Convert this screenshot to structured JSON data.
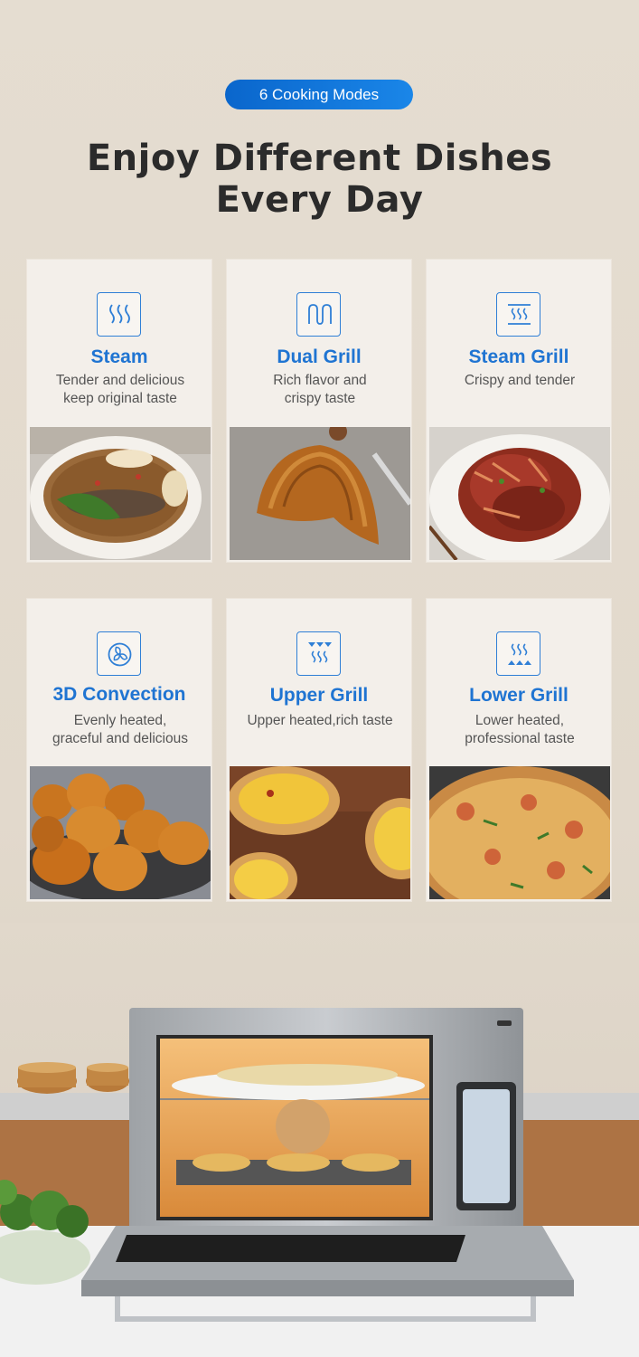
{
  "badge": {
    "label": "6 Cooking Modes"
  },
  "headline": {
    "line1": "Enjoy Different Dishes",
    "line2": "Every Day"
  },
  "colors": {
    "accent": "#1f74d2",
    "badge_start": "#0a66cc",
    "badge_end": "#1a86e8",
    "background": "#e5ddd1"
  },
  "modes": [
    {
      "title": "Steam",
      "desc_line1": "Tender and delicious",
      "desc_line2": "keep original taste",
      "icon": "steam-icon",
      "photo": "soup-photo"
    },
    {
      "title": "Dual Grill",
      "desc_line1": "Rich flavor and",
      "desc_line2": "crispy taste",
      "icon": "dual-grill-icon",
      "photo": "croissant-photo"
    },
    {
      "title": "Steam Grill",
      "desc_line1": "Crispy and tender",
      "desc_line2": "",
      "icon": "steam-grill-icon",
      "photo": "shredded-meat-photo"
    },
    {
      "title": "3D Convection",
      "desc_line1": "Evenly heated,",
      "desc_line2": "graceful and delicious",
      "icon": "fan-icon",
      "photo": "roast-potatoes-photo"
    },
    {
      "title": "Upper Grill",
      "desc_line1": "Upper heated,rich taste",
      "desc_line2": "",
      "icon": "upper-grill-icon",
      "photo": "egg-tarts-photo"
    },
    {
      "title": "Lower Grill",
      "desc_line1": "Lower heated,",
      "desc_line2": "professional taste",
      "icon": "lower-grill-icon",
      "photo": "pizza-photo"
    }
  ]
}
